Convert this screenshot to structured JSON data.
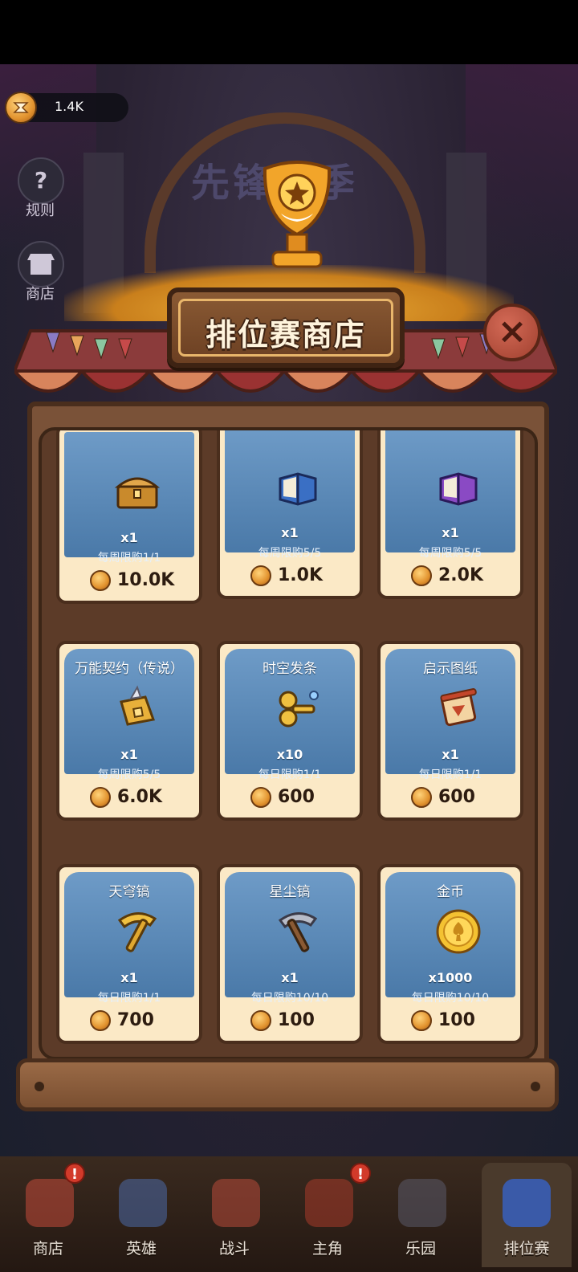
{
  "currency": {
    "value": "1.4K",
    "icon": "trophy-coin-icon"
  },
  "side_menu": [
    {
      "label": "规则",
      "icon": "question-icon"
    },
    {
      "label": "商店",
      "icon": "shop-icon"
    }
  ],
  "season_title": "先锋赛季",
  "shop": {
    "title": "排位赛商店",
    "close_icon": "close-icon",
    "items": [
      {
        "name": "",
        "qty": "x1",
        "limit": "每周限购1/1",
        "price": "10.0K",
        "icon": "treasure-chest-icon"
      },
      {
        "name": "",
        "qty": "x1",
        "limit": "每周限购5/5",
        "price": "1.0K",
        "icon": "blue-book-icon"
      },
      {
        "name": "",
        "qty": "x1",
        "limit": "每周限购5/5",
        "price": "2.0K",
        "icon": "purple-book-icon"
      },
      {
        "name": "万能契约（传说）",
        "qty": "x1",
        "limit": "每周限购5/5",
        "price": "6.0K",
        "icon": "golden-book-icon"
      },
      {
        "name": "时空发条",
        "qty": "x10",
        "limit": "每日限购1/1",
        "price": "600",
        "icon": "windup-key-icon"
      },
      {
        "name": "启示图纸",
        "qty": "x1",
        "limit": "每日限购1/1",
        "price": "600",
        "icon": "scroll-icon"
      },
      {
        "name": "天穹镐",
        "qty": "x1",
        "limit": "每日限购1/1",
        "price": "700",
        "icon": "gold-pickaxe-icon"
      },
      {
        "name": "星尘镐",
        "qty": "x1",
        "limit": "每日限购10/10",
        "price": "100",
        "icon": "iron-pickaxe-icon"
      },
      {
        "name": "金币",
        "qty": "x1000",
        "limit": "每日限购10/10",
        "price": "100",
        "icon": "gold-coin-icon"
      }
    ]
  },
  "bottom_nav": [
    {
      "label": "商店",
      "badge": "!"
    },
    {
      "label": "英雄",
      "badge": ""
    },
    {
      "label": "战斗",
      "badge": ""
    },
    {
      "label": "主角",
      "badge": "!"
    },
    {
      "label": "乐园",
      "badge": ""
    },
    {
      "label": "排位赛",
      "badge": ""
    }
  ],
  "colors": {
    "card_top": "#4a79a8",
    "card_bottom": "#fbe9c6",
    "wood": "#7a5238",
    "badge": "#d23a2a"
  }
}
